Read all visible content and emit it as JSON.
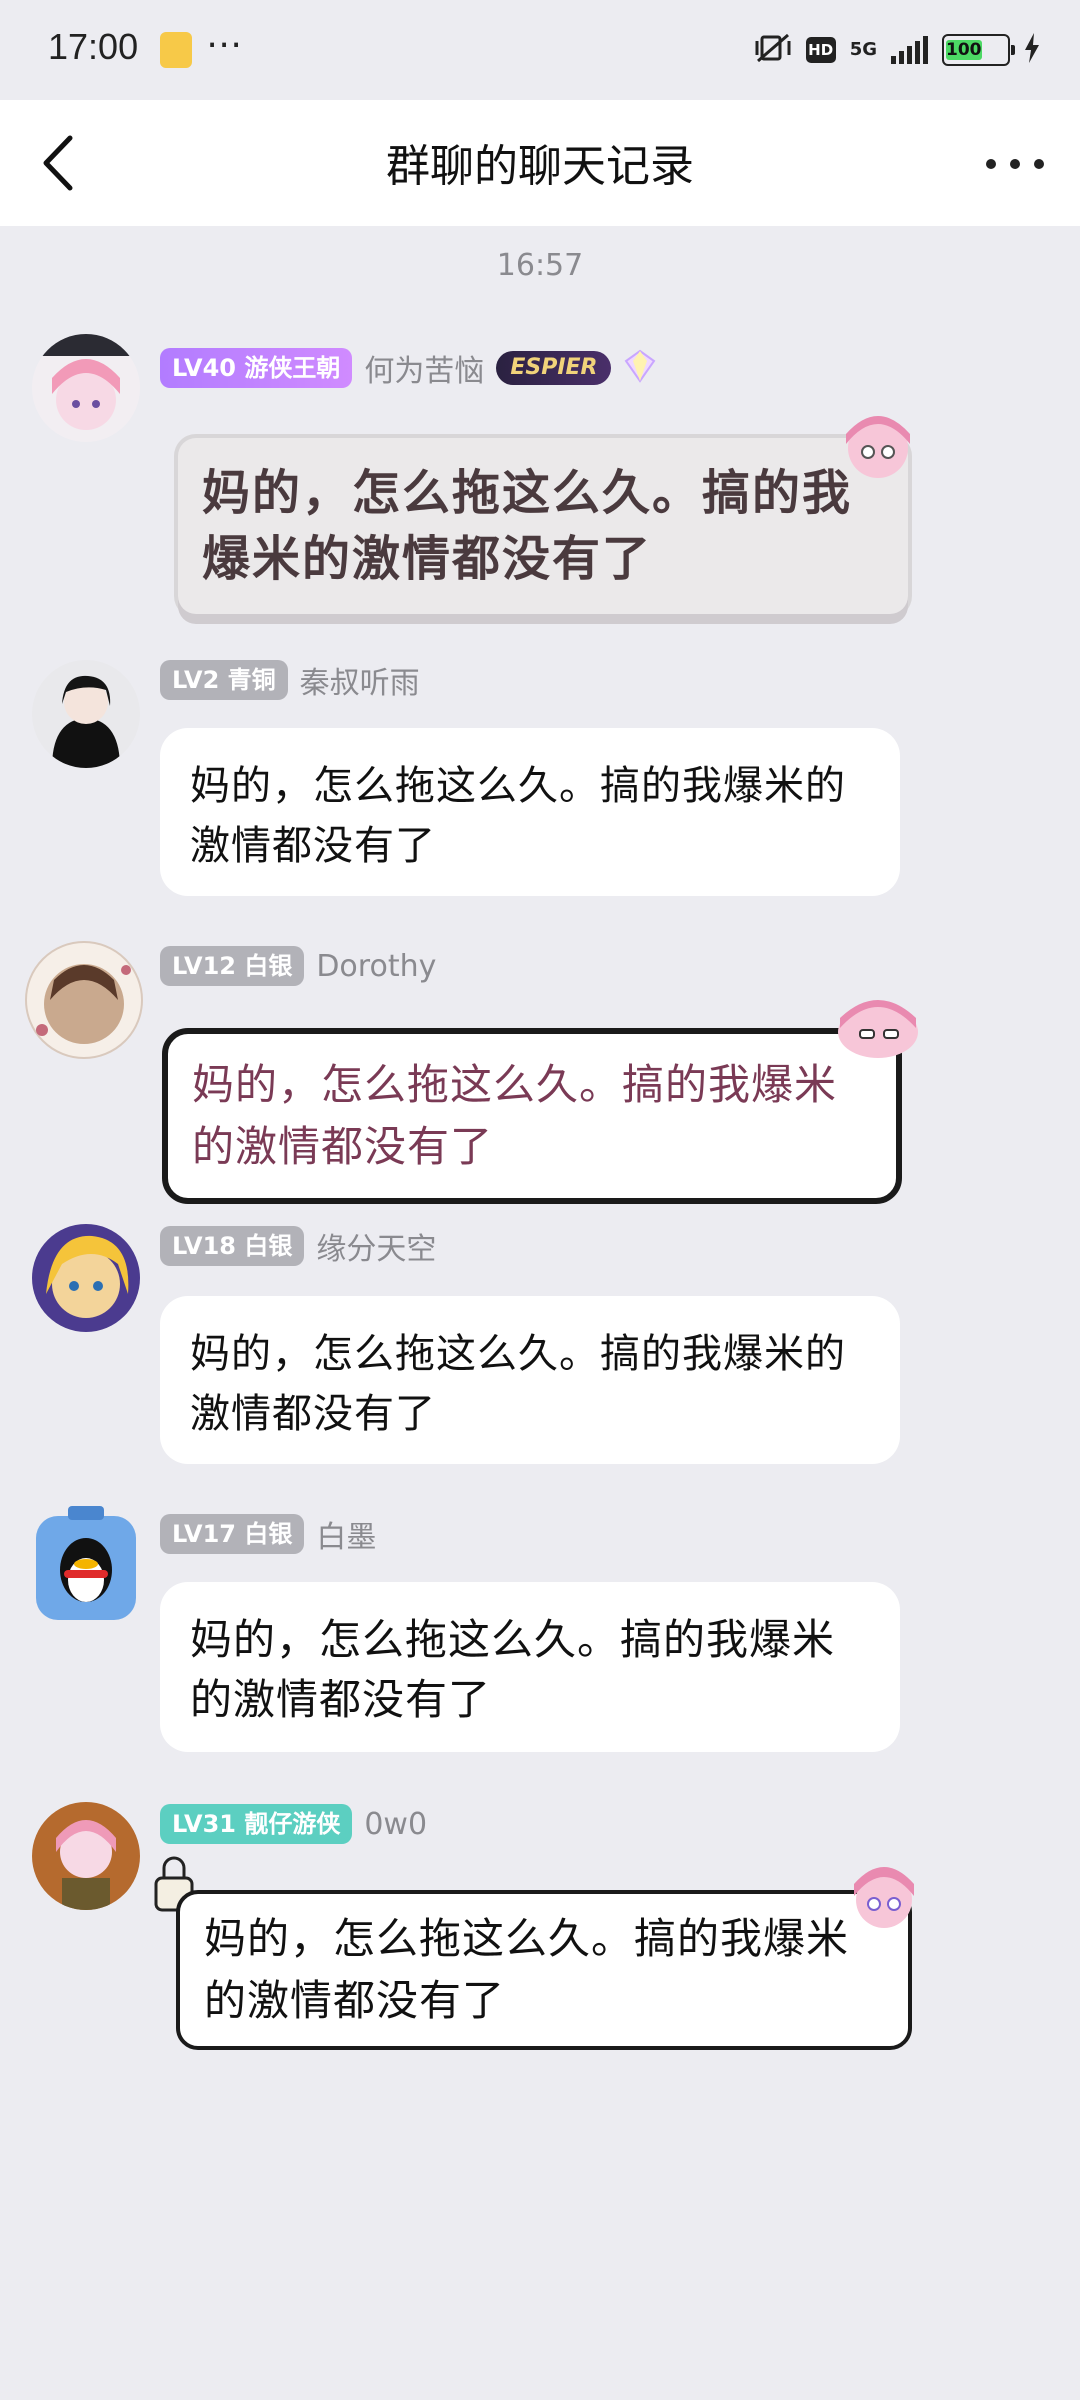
{
  "status_bar": {
    "time": "17:00",
    "more_glyph": "⋯",
    "hd": "HD",
    "network": "5G",
    "battery": "100",
    "battery_level": 1.0
  },
  "nav": {
    "title": "群聊的聊天记录"
  },
  "timestamp": "16:57",
  "messages": [
    {
      "level": "LV40 游侠王朝",
      "nickname": "何为苦恼",
      "badge": "ESPIER",
      "text": "妈的，怎么拖这么久。搞的我爆米的激情都没有了"
    },
    {
      "level": "LV2 青铜",
      "nickname": "秦叔听雨",
      "text": "妈的，怎么拖这么久。搞的我爆米的激情都没有了"
    },
    {
      "level": "LV12 白银",
      "nickname": "Dorothy",
      "text": "妈的，怎么拖这么久。搞的我爆米的激情都没有了"
    },
    {
      "level": "LV18 白银",
      "nickname": "缘分天空",
      "text": "妈的，怎么拖这么久。搞的我爆米的激情都没有了"
    },
    {
      "level": "LV17 白银",
      "nickname": "白墨",
      "text": "妈的，怎么拖这么久。搞的我爆米的激情都没有了"
    },
    {
      "level": "LV31 靓仔游侠",
      "nickname": "0w0",
      "text": "妈的，怎么拖这么久。搞的我爆米的激情都没有了"
    }
  ],
  "icons": {
    "back": "back-arrow-icon",
    "more": "more-dots-icon",
    "mute": "vibrate-mute-icon",
    "signal": "signal-bars-icon",
    "charging": "charging-bolt-icon"
  },
  "colors": {
    "background": "#ececf1",
    "bubble": "#ffffff",
    "level_gray": "#b2b2b8",
    "level_purple": "#b27cff",
    "level_teal": "#5ccfc1",
    "nickname": "#8a8a8f"
  }
}
